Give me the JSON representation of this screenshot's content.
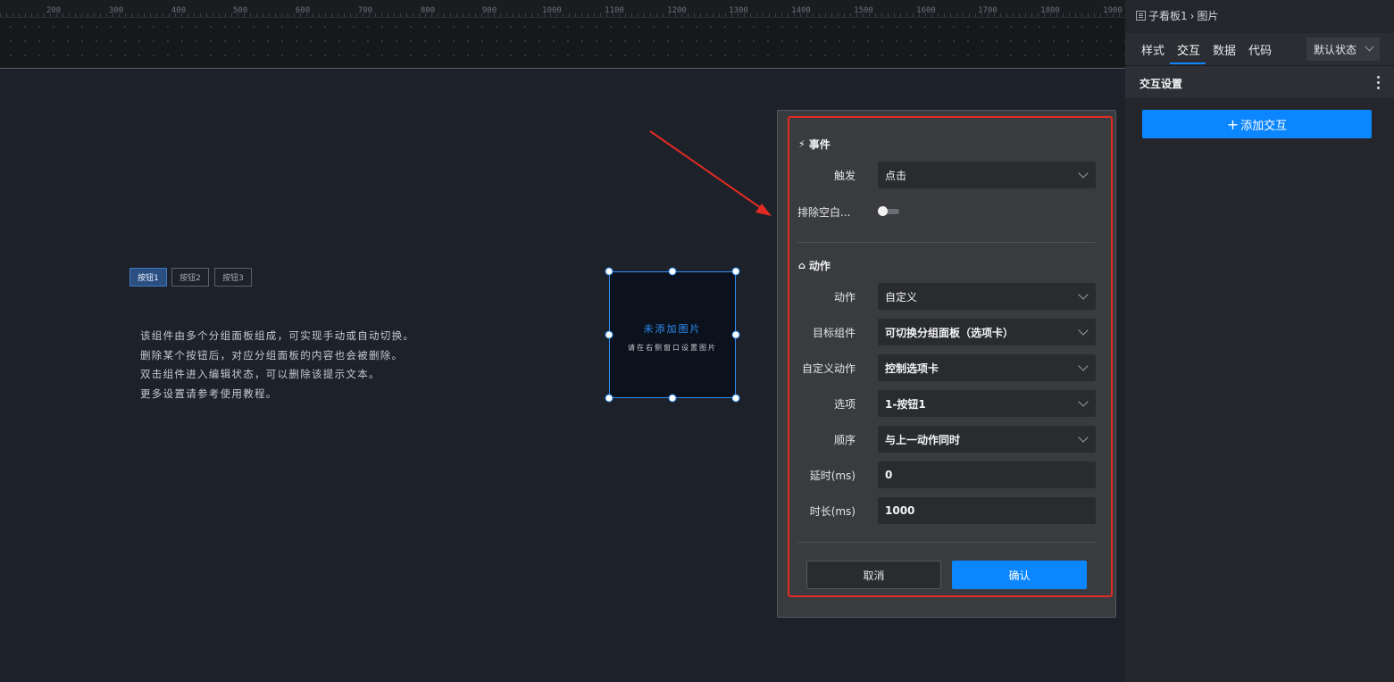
{
  "ruler": {
    "ticks": [
      "200",
      "300",
      "400",
      "500",
      "600",
      "700",
      "800",
      "900",
      "1000",
      "1100",
      "1200",
      "1300",
      "1400",
      "1500",
      "1600",
      "1700",
      "1800",
      "1900"
    ]
  },
  "canvas": {
    "tab_buttons": [
      "按钮1",
      "按钮2",
      "按钮3"
    ],
    "hint_lines": [
      "该组件由多个分组面板组成，可实现手动或自动切换。",
      "删除某个按钮后，对应分组面板的内容也会被删除。",
      "双击组件进入编辑状态，可以删除该提示文本。",
      "更多设置请参考使用教程。"
    ],
    "image_placeholder": {
      "title": "未添加图片",
      "subtitle": "请在右侧窗口设置图片"
    }
  },
  "panel": {
    "event_section": {
      "icon": "lightning-icon",
      "title": "事件"
    },
    "trigger": {
      "label": "触发",
      "value": "点击"
    },
    "exclude_blank": {
      "label": "排除空白...",
      "on": false
    },
    "action_section": {
      "icon": "action-icon",
      "title": "动作"
    },
    "action": {
      "label": "动作",
      "value": "自定义"
    },
    "target": {
      "label": "目标组件",
      "value": "可切换分组面板（选项卡）"
    },
    "custom_action": {
      "label": "自定义动作",
      "value": "控制选项卡"
    },
    "option": {
      "label": "选项",
      "value": "1-按钮1"
    },
    "order": {
      "label": "顺序",
      "value": "与上一动作同时"
    },
    "delay": {
      "label": "延时(ms)",
      "value": "0"
    },
    "duration": {
      "label": "时长(ms)",
      "value": "1000"
    },
    "cancel_label": "取消",
    "confirm_label": "确认"
  },
  "sidebar": {
    "breadcrumb": {
      "parent": "子看板1",
      "separator": "›",
      "current": "图片"
    },
    "tabs": [
      "样式",
      "交互",
      "数据",
      "代码"
    ],
    "active_tab": "交互",
    "state_select": "默认状态",
    "section_title": "交互设置",
    "add_button": "添加交互",
    "add_icon": "plus-icon"
  },
  "colors": {
    "accent": "#0b86ff",
    "highlight": "#e32b23",
    "selection": "#2d8cf0"
  }
}
